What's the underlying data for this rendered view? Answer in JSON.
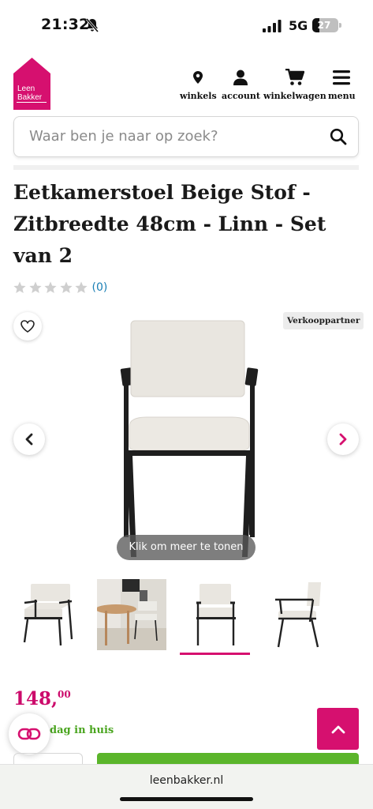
{
  "status_bar": {
    "time": "21:32",
    "network": "5G",
    "battery": "27",
    "battery_level": 0.27
  },
  "header": {
    "logo_line1": "Leen",
    "logo_line2": "Bakker",
    "nav": [
      {
        "label": "winkels",
        "icon": "map-pin-icon"
      },
      {
        "label": "account",
        "icon": "user-icon"
      },
      {
        "label": "winkelwagen",
        "icon": "shopping-cart-icon"
      },
      {
        "label": "menu",
        "icon": "hamburger-menu-icon"
      }
    ]
  },
  "search": {
    "placeholder": "Waar ben je naar op zoek?"
  },
  "product": {
    "title": "Eetkamerstoel Beige Stof - Zitbreedte 48cm - Linn - Set van 2",
    "rating_stars": 0,
    "review_count": "(0)",
    "seller_badge": "Verkooppartner",
    "more_button": "Klik om meer te tonen",
    "thumbnail_count": 4,
    "active_thumbnail": 3,
    "price_main": "148,",
    "price_cents": "00",
    "delivery": "dag in huis"
  },
  "browser": {
    "url": "leenbakker.nl"
  },
  "colors": {
    "brand": "#d6106f",
    "price": "#cc0a6b",
    "delivery": "#4aa51f",
    "cart": "#5bb52b"
  }
}
